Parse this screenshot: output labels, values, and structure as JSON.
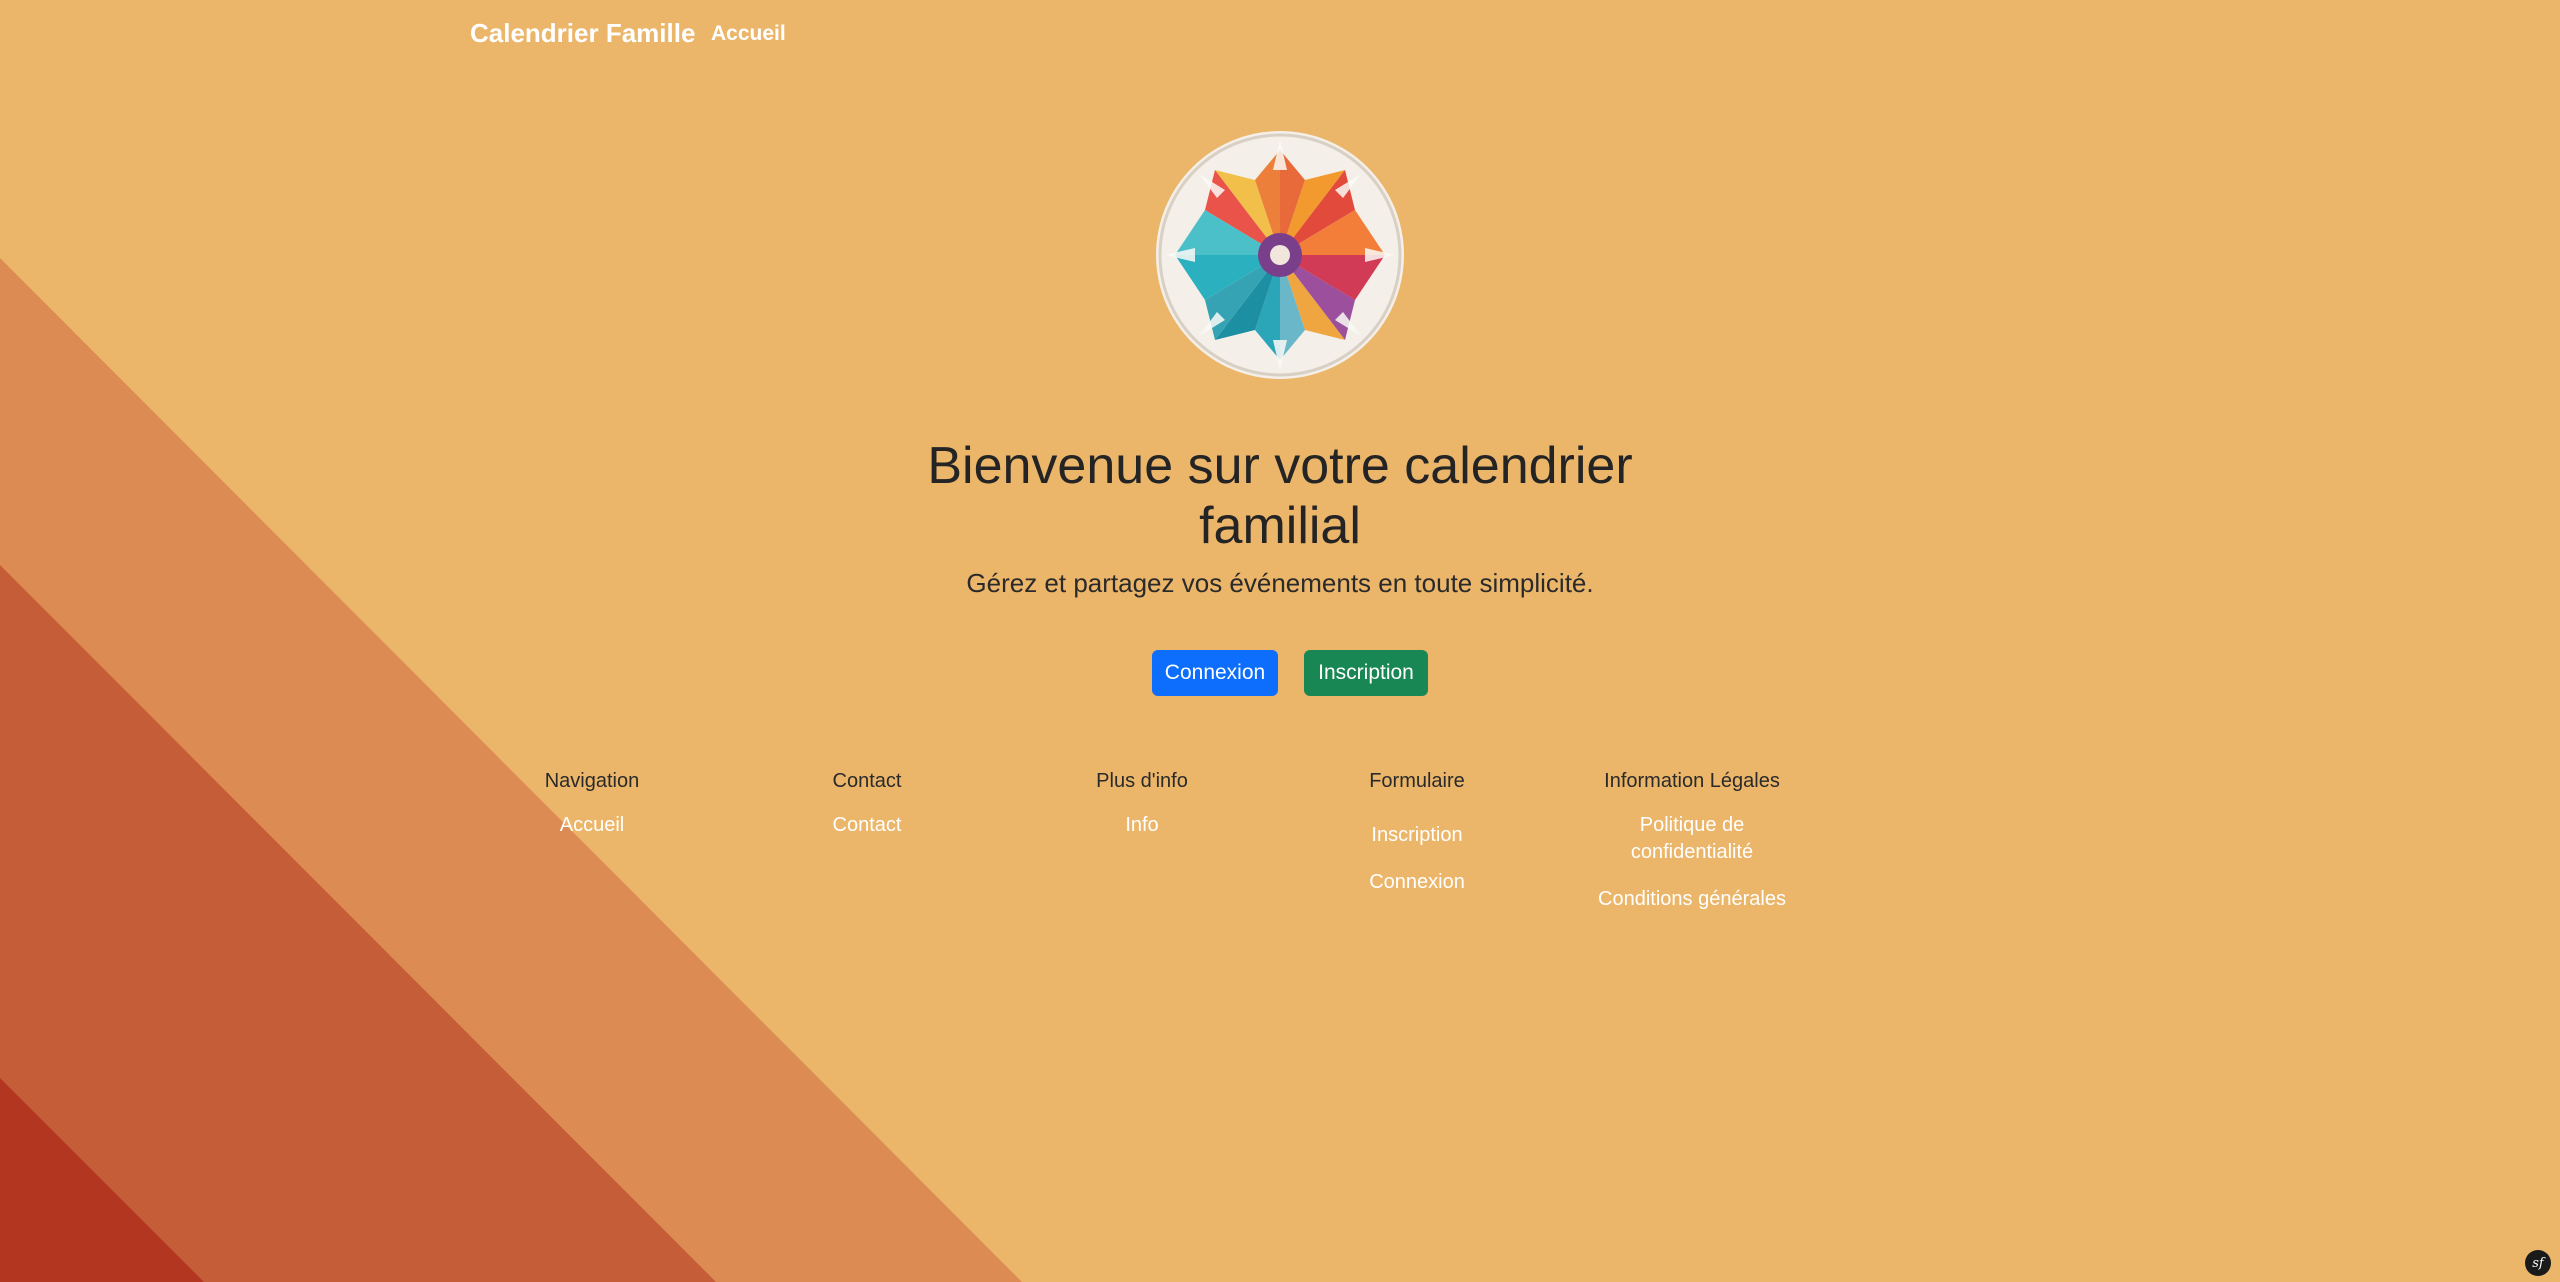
{
  "navbar": {
    "brand": "Calendrier Famille",
    "link_home": "Accueil"
  },
  "hero": {
    "title": "Bienvenue sur votre calendrier familial",
    "subtitle": "Gérez et partagez vos événements en toute simplicité.",
    "login_button": "Connexion",
    "register_button": "Inscription"
  },
  "footer": {
    "columns": [
      {
        "heading": "Navigation",
        "links": [
          "Accueil"
        ]
      },
      {
        "heading": "Contact",
        "links": [
          "Contact"
        ]
      },
      {
        "heading": "Plus d'info",
        "links": [
          "Info"
        ]
      },
      {
        "heading": "Formulaire",
        "links": [
          "Inscription",
          "Connexion"
        ]
      },
      {
        "heading": "Information Légales",
        "links": [
          "Politique de confidentialité",
          "Conditions générales"
        ]
      }
    ]
  },
  "debug_badge": "sf",
  "colors": {
    "background": "#ebb66a",
    "stripe_light": "#dc8b52",
    "stripe_mid": "#c65d39",
    "stripe_dark": "#b33620",
    "primary": "#0d6efd",
    "success": "#198754"
  },
  "icons": {
    "logo": "origami-rosette-logo",
    "debug": "symfony-logo-icon"
  }
}
